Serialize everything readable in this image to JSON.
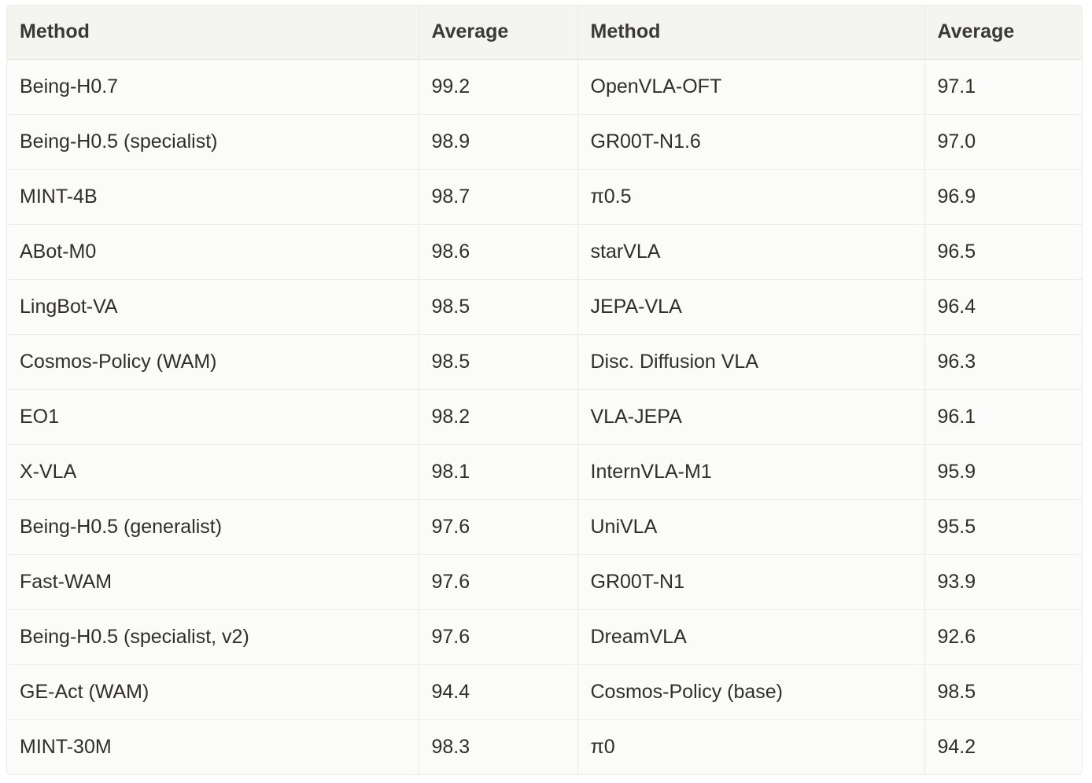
{
  "table": {
    "headers": [
      "Method",
      "Average",
      "Method",
      "Average"
    ],
    "rows": [
      [
        "Being-H0.7",
        "99.2",
        "OpenVLA-OFT",
        "97.1"
      ],
      [
        "Being-H0.5 (specialist)",
        "98.9",
        "GR00T-N1.6",
        "97.0"
      ],
      [
        "MINT-4B",
        "98.7",
        "π0.5",
        "96.9"
      ],
      [
        "ABot-M0",
        "98.6",
        "starVLA",
        "96.5"
      ],
      [
        "LingBot-VA",
        "98.5",
        "JEPA-VLA",
        "96.4"
      ],
      [
        "Cosmos-Policy (WAM)",
        "98.5",
        "Disc. Diffusion VLA",
        "96.3"
      ],
      [
        "EO1",
        "98.2",
        "VLA-JEPA",
        "96.1"
      ],
      [
        "X-VLA",
        "98.1",
        "InternVLA-M1",
        "95.9"
      ],
      [
        "Being-H0.5 (generalist)",
        "97.6",
        "UniVLA",
        "95.5"
      ],
      [
        "Fast-WAM",
        "97.6",
        "GR00T-N1",
        "93.9"
      ],
      [
        "Being-H0.5 (specialist, v2)",
        "97.6",
        "DreamVLA",
        "92.6"
      ],
      [
        "GE-Act (WAM)",
        "94.4",
        "Cosmos-Policy (base)",
        "98.5"
      ],
      [
        "MINT-30M",
        "98.3",
        "π0",
        "94.2"
      ]
    ]
  }
}
